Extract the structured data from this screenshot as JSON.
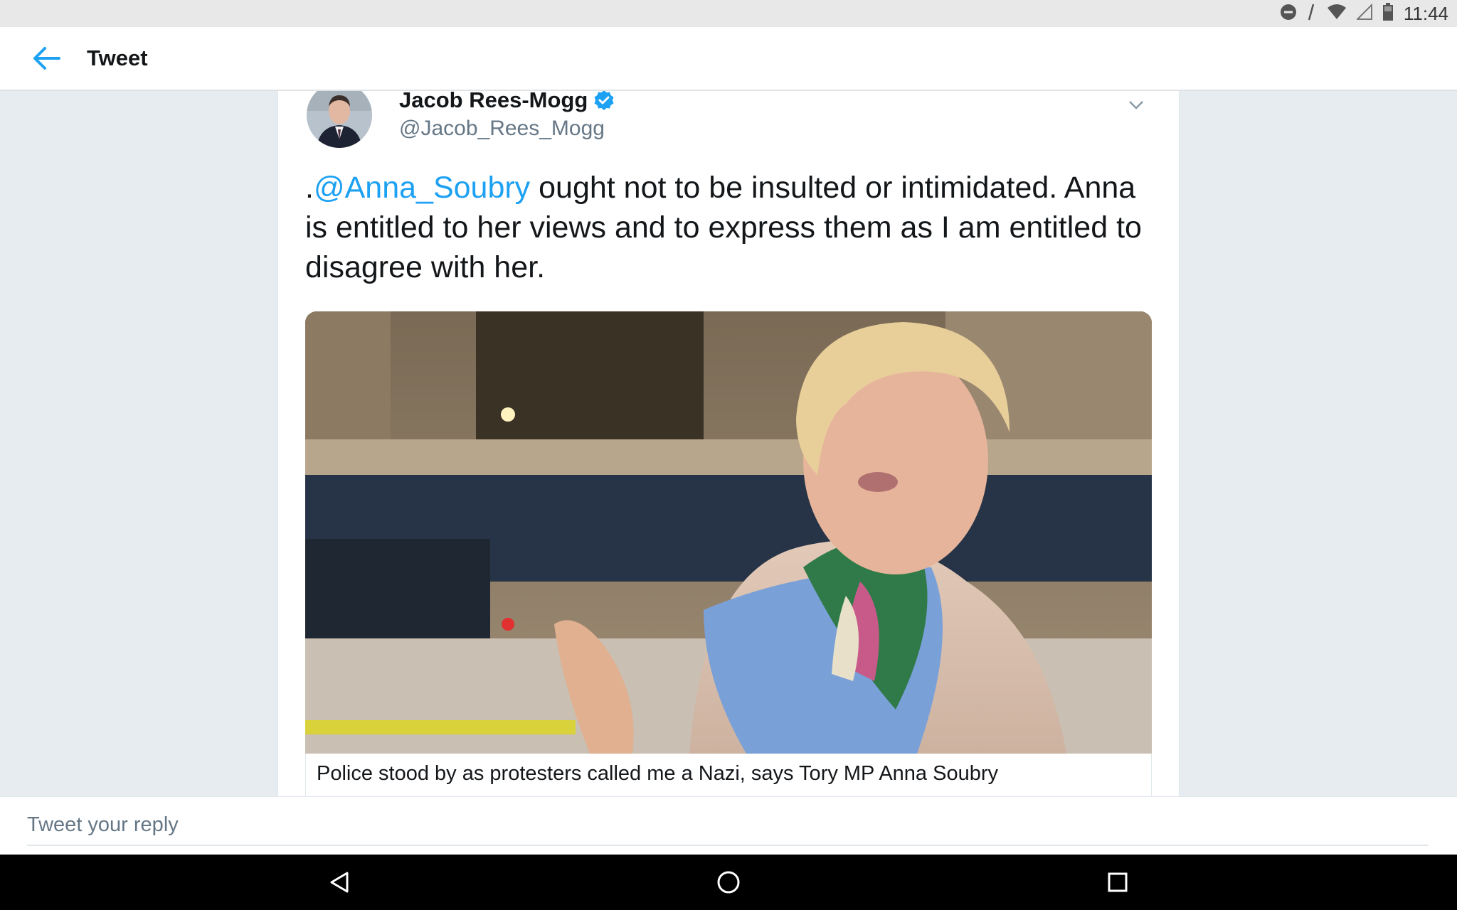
{
  "status_bar": {
    "time": "11:44"
  },
  "app_bar": {
    "title": "Tweet"
  },
  "tweet": {
    "author_name": "Jacob Rees-Mogg",
    "handle": "@Jacob_Rees_Mogg",
    "text_prefix": ".",
    "mention": "@Anna_Soubry",
    "text_rest": " ought not to be insulted or intimidated. Anna is entitled to her views and to express them as I am entitled to disagree with her.",
    "link_card_title": "Police stood by as protesters called me a Nazi, says Tory MP Anna Soubry"
  },
  "reply": {
    "placeholder": "Tweet your reply"
  },
  "colors": {
    "accent": "#1da1f2",
    "background": "#e6ecf0",
    "text": "#14171a",
    "secondary": "#657786"
  }
}
